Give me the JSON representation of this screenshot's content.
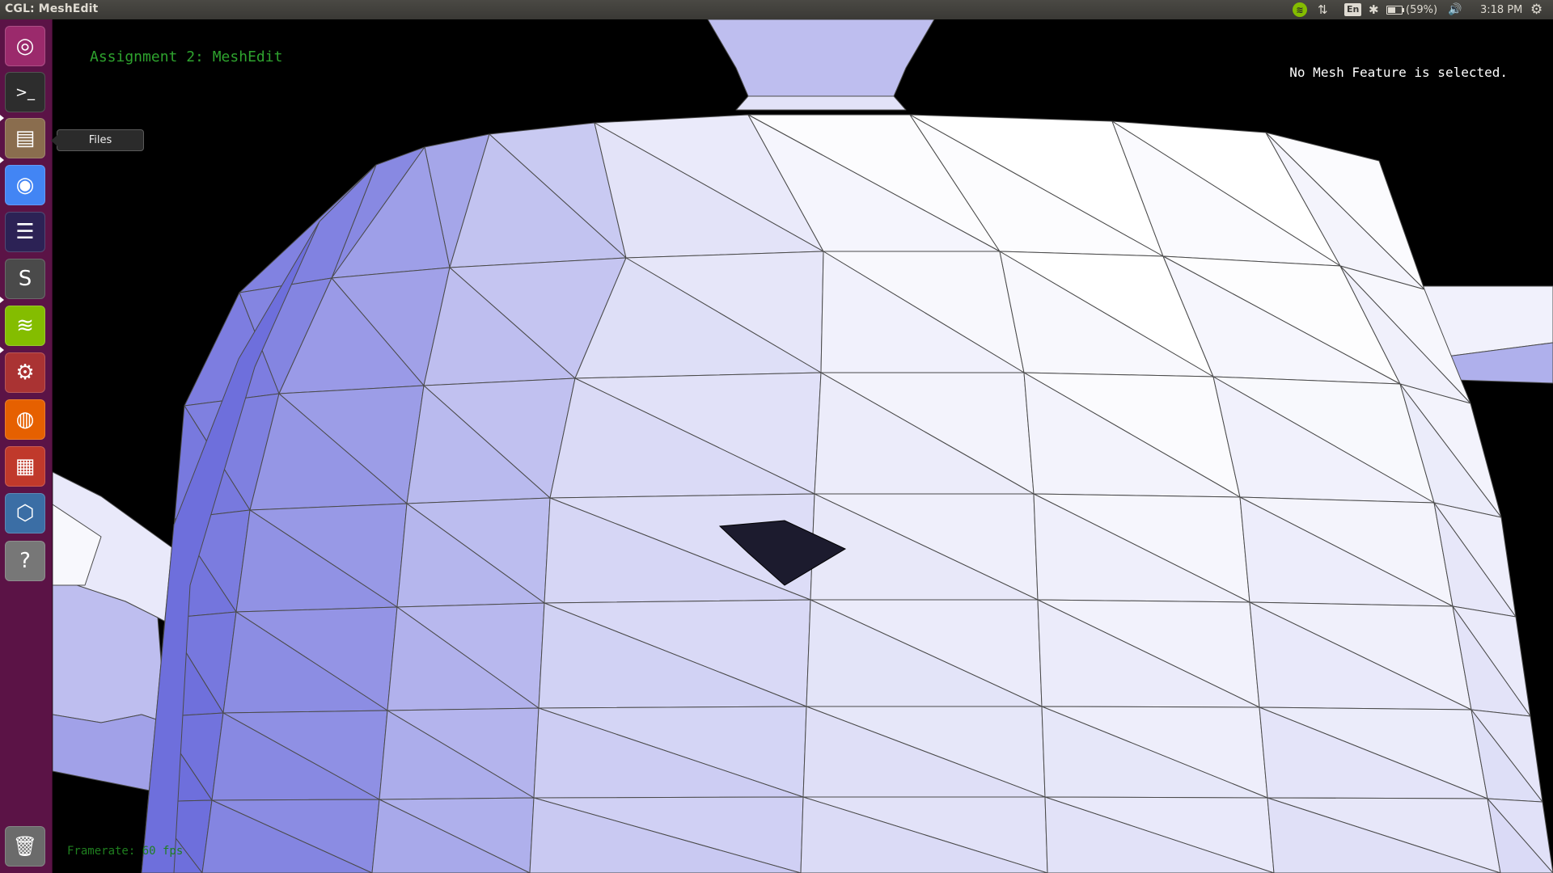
{
  "window": {
    "title": "CGL: MeshEdit"
  },
  "tray": {
    "spotify_icon": "spotify-icon",
    "network_icon": "network-updown-icon",
    "network_glyph": "⇅",
    "keyboard_label": "En",
    "bluetooth_glyph": "✱",
    "battery_text": "(59%)",
    "battery_level": 0.59,
    "volume_glyph": "🔊",
    "clock": "3:18 PM",
    "settings_glyph": "⚙"
  },
  "launcher": {
    "tooltip": "Files",
    "items": [
      {
        "name": "ubuntu-dash",
        "glyph": "◎",
        "bg": "#9b2a6c"
      },
      {
        "name": "terminal",
        "glyph": ">_",
        "bg": "#2d2d2d"
      },
      {
        "name": "files",
        "glyph": "▤",
        "bg": "#8a6d4e"
      },
      {
        "name": "chrome",
        "glyph": "◉",
        "bg": "#4285f4"
      },
      {
        "name": "eclipse",
        "glyph": "☰",
        "bg": "#2c2255"
      },
      {
        "name": "sublime-text",
        "glyph": "S",
        "bg": "#4a4a4a"
      },
      {
        "name": "spotify",
        "glyph": "≋",
        "bg": "#84bd00"
      },
      {
        "name": "system-settings",
        "glyph": "⚙",
        "bg": "#a33"
      },
      {
        "name": "firefox",
        "glyph": "◍",
        "bg": "#e66000"
      },
      {
        "name": "software-center",
        "glyph": "▦",
        "bg": "#c0392b"
      },
      {
        "name": "virtualbox",
        "glyph": "⬡",
        "bg": "#3b6ea5"
      },
      {
        "name": "help",
        "glyph": "?",
        "bg": "#777"
      }
    ],
    "trash": {
      "name": "trash",
      "glyph": "🗑",
      "bg": "#6b6b6b"
    }
  },
  "viewport": {
    "app_title": "Assignment 2: MeshEdit",
    "selection_status": "No Mesh Feature is selected.",
    "framerate": "Framerate: 60 fps"
  },
  "colors": {
    "mesh_dark": "#6e6fdc",
    "mesh_light": "#ffffff",
    "wire": "#4a4a4a",
    "hole": "#1c1b2e",
    "launcher_bg": "#5b1346"
  }
}
